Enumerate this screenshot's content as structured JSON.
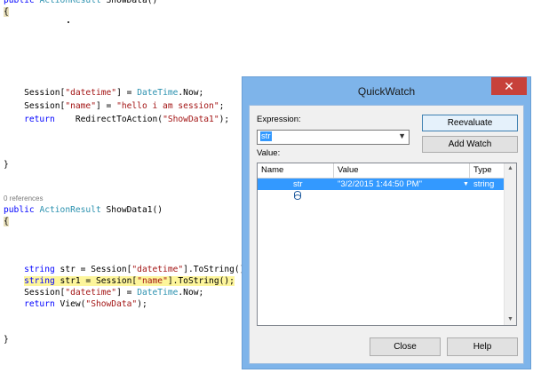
{
  "code": {
    "lines": [
      {
        "parts": [
          {
            "t": "public ",
            "c": "kw"
          },
          {
            "t": "ActionResult",
            "c": "ty"
          },
          {
            "t": " ShowData()",
            "c": ""
          }
        ]
      },
      {
        "parts": [
          {
            "t": "{",
            "c": "brace"
          }
        ]
      },
      {
        "parts": [
          {
            "t": "    Session[",
            "c": ""
          },
          {
            "t": "\"datetime\"",
            "c": "st"
          },
          {
            "t": "] = ",
            "c": ""
          },
          {
            "t": "DateTime",
            "c": "ty"
          },
          {
            "t": ".Now;",
            "c": ""
          }
        ]
      },
      {
        "parts": [
          {
            "t": "    Session[",
            "c": ""
          },
          {
            "t": "\"name\"",
            "c": "st"
          },
          {
            "t": "] = ",
            "c": ""
          },
          {
            "t": "\"hello i am session\"",
            "c": "st"
          },
          {
            "t": ";",
            "c": ""
          }
        ]
      },
      {
        "parts": [
          {
            "t": "    ",
            "c": ""
          },
          {
            "t": "return",
            "c": "kw"
          },
          {
            "t": "    RedirectToAction(",
            "c": ""
          },
          {
            "t": "\"ShowData1\"",
            "c": "st"
          },
          {
            "t": ");",
            "c": ""
          }
        ]
      },
      {
        "parts": [
          {
            "t": "}",
            "c": ""
          }
        ]
      },
      {
        "parts": [
          {
            "t": "public ",
            "c": "kw"
          },
          {
            "t": "ActionResult",
            "c": "ty"
          },
          {
            "t": " ShowData1()",
            "c": ""
          }
        ]
      },
      {
        "parts": [
          {
            "t": "{",
            "c": "brace"
          }
        ]
      },
      {
        "parts": [
          {
            "t": "    ",
            "c": ""
          },
          {
            "t": "string",
            "c": "kw"
          },
          {
            "t": " str = Session[",
            "c": ""
          },
          {
            "t": "\"datetime\"",
            "c": "st"
          },
          {
            "t": "].ToString()",
            "c": ""
          }
        ]
      },
      {
        "parts": [
          {
            "t": "    ",
            "c": ""
          },
          {
            "t": "string",
            "c": "kw"
          },
          {
            "t": " str1 = Session[",
            "c": ""
          },
          {
            "t": "\"name\"",
            "c": "st"
          },
          {
            "t": "].ToString();",
            "c": ""
          }
        ],
        "highlight": true
      },
      {
        "parts": [
          {
            "t": "    Session[",
            "c": ""
          },
          {
            "t": "\"datetime\"",
            "c": "st"
          },
          {
            "t": "] = ",
            "c": ""
          },
          {
            "t": "DateTime",
            "c": "ty"
          },
          {
            "t": ".Now;",
            "c": ""
          }
        ]
      },
      {
        "parts": [
          {
            "t": "    ",
            "c": ""
          },
          {
            "t": "return",
            "c": "kw"
          },
          {
            "t": " View(",
            "c": ""
          },
          {
            "t": "\"ShowData\"",
            "c": "st"
          },
          {
            "t": ");",
            "c": ""
          }
        ]
      },
      {
        "parts": [
          {
            "t": "}",
            "c": ""
          }
        ]
      }
    ],
    "references_label": "0 references"
  },
  "quickwatch": {
    "title": "QuickWatch",
    "close_glyph": "✕",
    "expression_label": "Expression:",
    "expression_value": "str",
    "value_label": "Value:",
    "reevaluate_label": "Reevaluate",
    "add_watch_label": "Add Watch",
    "columns": [
      "Name",
      "Value",
      "Type"
    ],
    "rows": [
      {
        "name": "str",
        "value": "\"3/2/2015 1:44:50 PM\"",
        "type": "string"
      }
    ],
    "close_label": "Close",
    "help_label": "Help",
    "icons": {
      "dropdown": "chevron-down-icon",
      "field": "field-icon",
      "magnifier": "magnifier-icon"
    }
  }
}
